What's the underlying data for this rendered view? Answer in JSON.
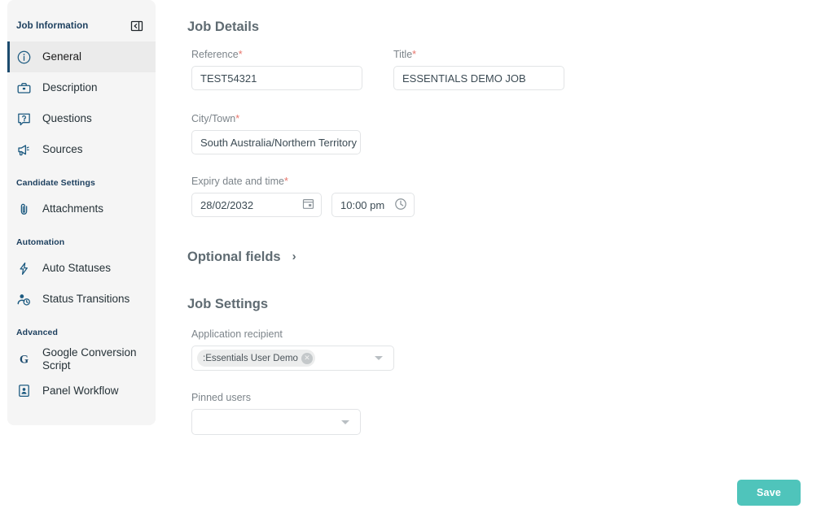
{
  "sidebar": {
    "title": "Job Information",
    "collapse_icon": "panel-collapse-icon",
    "groups": [
      {
        "label": "",
        "items": [
          {
            "label": "General",
            "icon": "info-circle-icon",
            "active": true
          },
          {
            "label": "Description",
            "icon": "briefcase-icon",
            "active": false
          },
          {
            "label": "Questions",
            "icon": "question-box-icon",
            "active": false
          },
          {
            "label": "Sources",
            "icon": "megaphone-icon",
            "active": false
          }
        ]
      },
      {
        "label": "Candidate Settings",
        "items": [
          {
            "label": "Attachments",
            "icon": "paperclip-icon",
            "active": false
          }
        ]
      },
      {
        "label": "Automation",
        "items": [
          {
            "label": "Auto Statuses",
            "icon": "lightning-bolt-icon",
            "active": false
          },
          {
            "label": "Status Transitions",
            "icon": "user-clock-icon",
            "active": false
          }
        ]
      },
      {
        "label": "Advanced",
        "items": [
          {
            "label": "Google Conversion Script",
            "icon": "google-g-icon",
            "active": false
          },
          {
            "label": "Panel Workflow",
            "icon": "id-badge-icon",
            "active": false
          }
        ]
      }
    ]
  },
  "main": {
    "job_details_heading": "Job Details",
    "optional_fields_label": "Optional fields",
    "optional_fields_chevron": "chevron-right-icon",
    "job_settings_heading": "Job Settings",
    "fields": {
      "reference": {
        "label": "Reference",
        "required_marker": "*",
        "value": "TEST54321"
      },
      "title": {
        "label": "Title",
        "required_marker": "*",
        "value": "ESSENTIALS DEMO JOB"
      },
      "city_town": {
        "label": "City/Town",
        "required_marker": "*",
        "value": "South Australia/Northern Territory"
      },
      "expiry": {
        "label": "Expiry date and time",
        "required_marker": "*",
        "date_value": "28/02/2032",
        "date_icon": "calendar-icon",
        "time_value": "10:00 pm",
        "time_icon": "clock-icon"
      },
      "application_recipient": {
        "label": "Application recipient",
        "chip_label": ":Essentials User Demo",
        "chip_remove_icon": "chip-remove-icon",
        "dropdown_icon": "caret-down-icon"
      },
      "pinned_users": {
        "label": "Pinned users",
        "value": "",
        "dropdown_icon": "caret-down-icon"
      }
    }
  },
  "footer": {
    "save_label": "Save"
  },
  "colors": {
    "sidebar_bg": "#f5f5f5",
    "active_row_bg": "#ebebeb",
    "active_accent": "#1c4b6e",
    "icon_blue": "#1c5a80",
    "heading_gray": "#5f6b72",
    "label_gray": "#7c848a",
    "required_red": "#e8756b",
    "input_border": "#e2e4e6",
    "save_teal": "#4fc4bb"
  }
}
